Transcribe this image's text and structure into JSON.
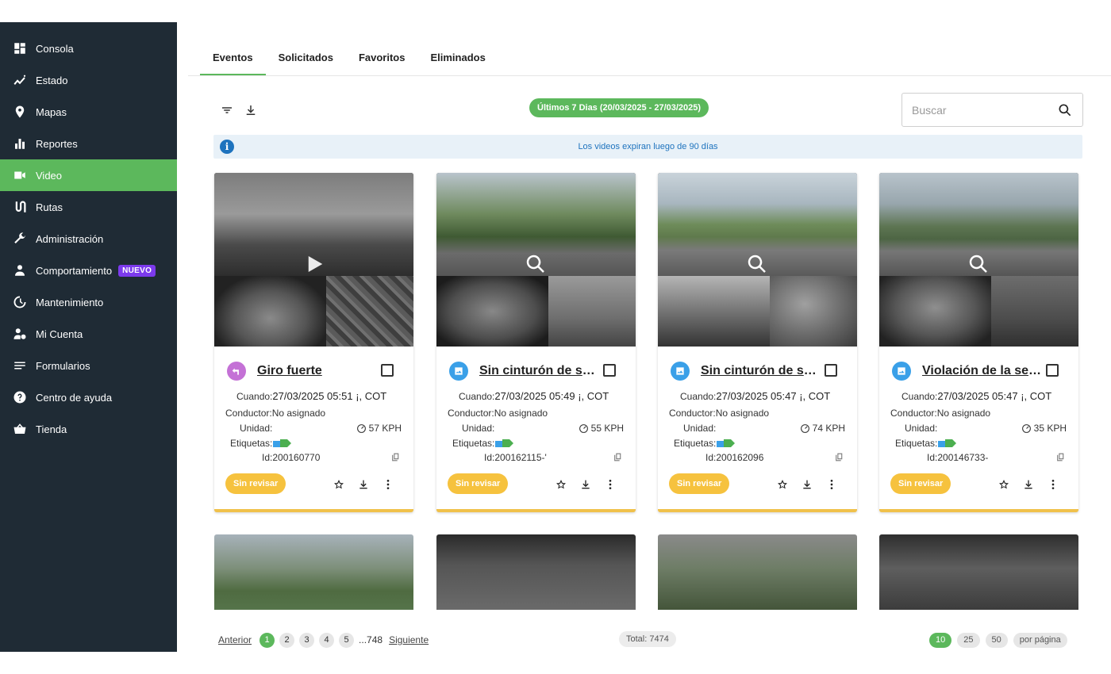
{
  "sidebar": {
    "items": [
      {
        "label": "Consola",
        "icon": "dashboard-icon"
      },
      {
        "label": "Estado",
        "icon": "trend-line-icon"
      },
      {
        "label": "Mapas",
        "icon": "map-pin-icon"
      },
      {
        "label": "Reportes",
        "icon": "bar-chart-icon"
      },
      {
        "label": "Video",
        "icon": "video-camera-icon",
        "active": true
      },
      {
        "label": "Rutas",
        "icon": "route-icon"
      },
      {
        "label": "Administración",
        "icon": "wrench-icon"
      },
      {
        "label": "Comportamiento",
        "icon": "person-icon",
        "badge": "NUEVO"
      },
      {
        "label": "Mantenimiento",
        "icon": "maintenance-icon"
      },
      {
        "label": "Mi Cuenta",
        "icon": "account-settings-icon"
      },
      {
        "label": "Formularios",
        "icon": "forms-icon"
      },
      {
        "label": "Centro de ayuda",
        "icon": "help-icon"
      },
      {
        "label": "Tienda",
        "icon": "basket-icon"
      }
    ]
  },
  "tabs": [
    "Eventos",
    "Solicitados",
    "Favoritos",
    "Eliminados"
  ],
  "toolbar": {
    "date_range": "Últimos 7 Dias (20/03/2025 - 27/03/2025)",
    "search_placeholder": "Buscar"
  },
  "info": {
    "message": "Los videos expiran luego de 90 días",
    "icon": "i"
  },
  "labels": {
    "when": "Cuando:",
    "driver": "Conductor:",
    "unit": "Unidad:",
    "tags": "Etiquetas:",
    "id": "Id:",
    "status": "Sin revisar"
  },
  "events": [
    {
      "title": "Giro fuerte",
      "type_icon": "sharp-turn-icon",
      "icon_color": "#c471d6",
      "when": "27/03/2025 05:51 ¡, COT",
      "driver": "No asignado",
      "speed": "57 KPH",
      "id": "200160770",
      "thumb_overlay": "play-icon"
    },
    {
      "title": "Sin cinturón de seg...",
      "type_icon": "image-icon",
      "icon_color": "#3aa0e8",
      "when": "27/03/2025 05:49 ¡, COT",
      "driver": "No asignado",
      "speed": "55 KPH",
      "id": "200162115-'",
      "thumb_overlay": "zoom-icon"
    },
    {
      "title": "Sin cinturón de seg...",
      "type_icon": "image-icon",
      "icon_color": "#3aa0e8",
      "when": "27/03/2025 05:47 ¡, COT",
      "driver": "No asignado",
      "speed": "74 KPH",
      "id": "200162096",
      "thumb_overlay": "zoom-icon"
    },
    {
      "title": "Violación de la señ...",
      "type_icon": "image-icon",
      "icon_color": "#3aa0e8",
      "when": "27/03/2025 05:47 ¡, COT",
      "driver": "No asignado",
      "speed": "35 KPH",
      "id": "200146733-",
      "thumb_overlay": "zoom-icon"
    }
  ],
  "pagination": {
    "prev": "Anterior",
    "pages": [
      "1",
      "2",
      "3",
      "4",
      "5"
    ],
    "ellipsis": "...",
    "last": "748",
    "next": "Siguiente",
    "total": "Total: 7474",
    "page_sizes": [
      "10",
      "25",
      "50"
    ],
    "per_page": "por página"
  },
  "colors": {
    "sidebar_bg": "#1f2b35",
    "accent_green": "#5cb85c",
    "status_yellow": "#f6c23e",
    "info_blue": "#1e73be",
    "badge_purple": "#7c3aed"
  }
}
